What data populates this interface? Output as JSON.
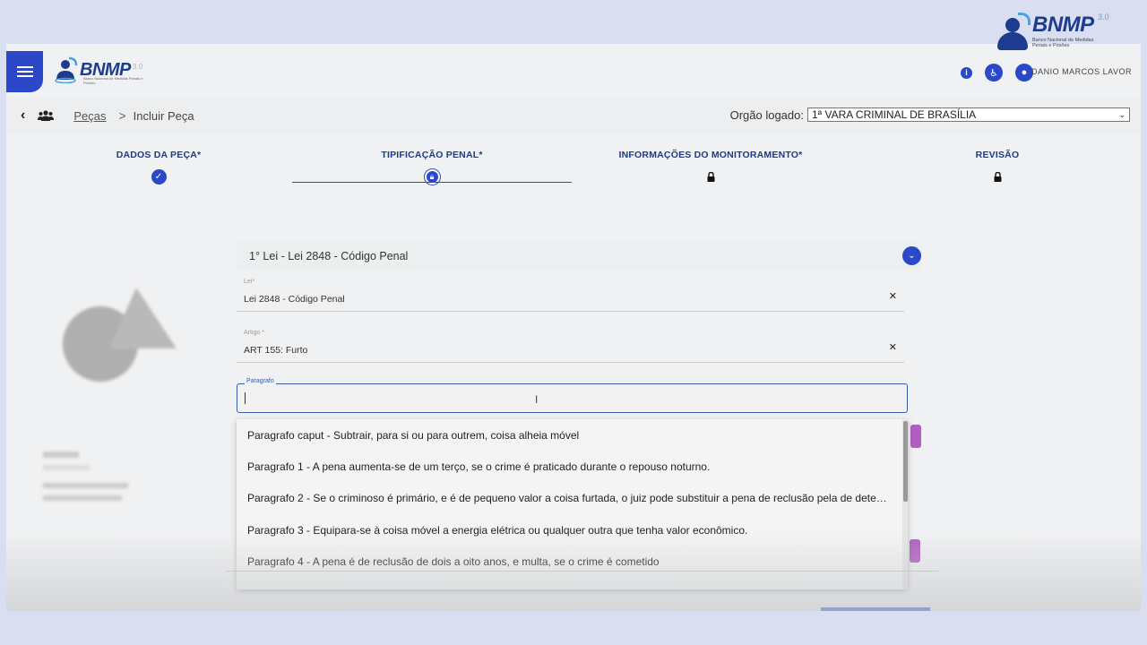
{
  "topbar": {
    "logo_text": "BNMP",
    "logo_version": "3.0",
    "logo_subtitle": "Banco Nacional de Medidas Penais e Prisões",
    "user_name": "DANIO MARCOS LAVOR"
  },
  "breadcrumb": {
    "link": "Peças",
    "separator": ">",
    "current": "Incluir Peça"
  },
  "orgao": {
    "label": "Orgão logado:",
    "value": "1ª VARA CRIMINAL DE BRASÍLIA"
  },
  "steps": [
    {
      "label": "DADOS DA PEÇA*",
      "state": "done"
    },
    {
      "label": "TIPIFICAÇÃO PENAL*",
      "state": "current"
    },
    {
      "label": "INFORMAÇÕES DO MONITORAMENTO*",
      "state": "locked"
    },
    {
      "label": "REVISÃO",
      "state": "locked"
    }
  ],
  "law_section": {
    "title": "1° Lei - Lei 2848 - Código Penal"
  },
  "fields": {
    "lei": {
      "label": "Lei*",
      "value": "Lei 2848 - Código Penal"
    },
    "artigo": {
      "label": "Artigo *",
      "value": "ART 155: Furto"
    },
    "paragrafo": {
      "label": "Paragrafo",
      "value": ""
    }
  },
  "dropdown_options": [
    "Paragrafo caput - Subtrair, para si ou para outrem, coisa alheia móvel",
    "Paragrafo 1 - A pena aumenta-se de um terço, se o crime é praticado durante o repouso noturno.",
    "Paragrafo 2 - Se o criminoso é primário, e é de pequeno valor a coisa furtada, o juiz pode substituir a pena de reclusão pela de detenção…",
    "Paragrafo 3 - Equipara-se à coisa móvel a energia elétrica ou qualquer outra que tenha valor econômico.",
    "Paragrafo 4 - A pena é de reclusão de dois a oito anos, e multa, se o crime é cometido"
  ],
  "corner_logo": {
    "title": "BNMP",
    "version": "3.0",
    "subtitle": "Banco Nacional de Medidas Penais e Prisões"
  },
  "colors": {
    "primary": "#2a48c8",
    "step_label": "#1e3a8a",
    "accent_purple": "#b05fc0"
  }
}
